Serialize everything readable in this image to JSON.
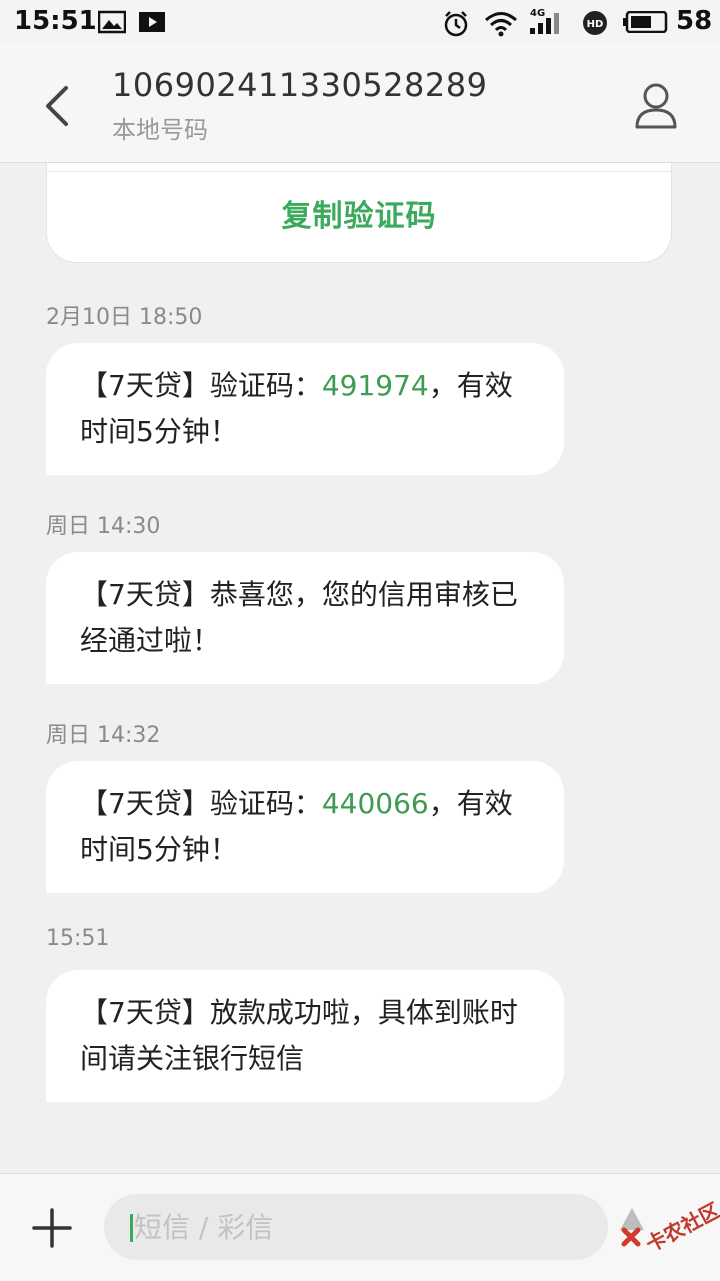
{
  "status_bar": {
    "time": "15:51",
    "battery_level": "58",
    "network": "4G"
  },
  "header": {
    "number": "106902411330528289",
    "subtitle": "本地号码"
  },
  "copy_card": {
    "button_label": "复制验证码"
  },
  "messages": [
    {
      "timestamp": "2月10日 18:50",
      "before": "【7天贷】验证码：",
      "code": "491974",
      "after": "，有效时间5分钟！"
    },
    {
      "timestamp": "周日 14:30",
      "text": "【7天贷】恭喜您，您的信用审核已经通过啦！"
    },
    {
      "timestamp": "周日 14:32",
      "before": "【7天贷】验证码：",
      "code": "440066",
      "after": "，有效时间5分钟！"
    },
    {
      "timestamp": "15:51",
      "text": "【7天贷】放款成功啦，具体到账时间请关注银行短信"
    }
  ],
  "compose": {
    "placeholder": "短信 / 彩信"
  },
  "watermark": {
    "text": "卡农社区"
  },
  "colors": {
    "accent_green": "#3caa5c",
    "code_green": "#3f9b52"
  }
}
